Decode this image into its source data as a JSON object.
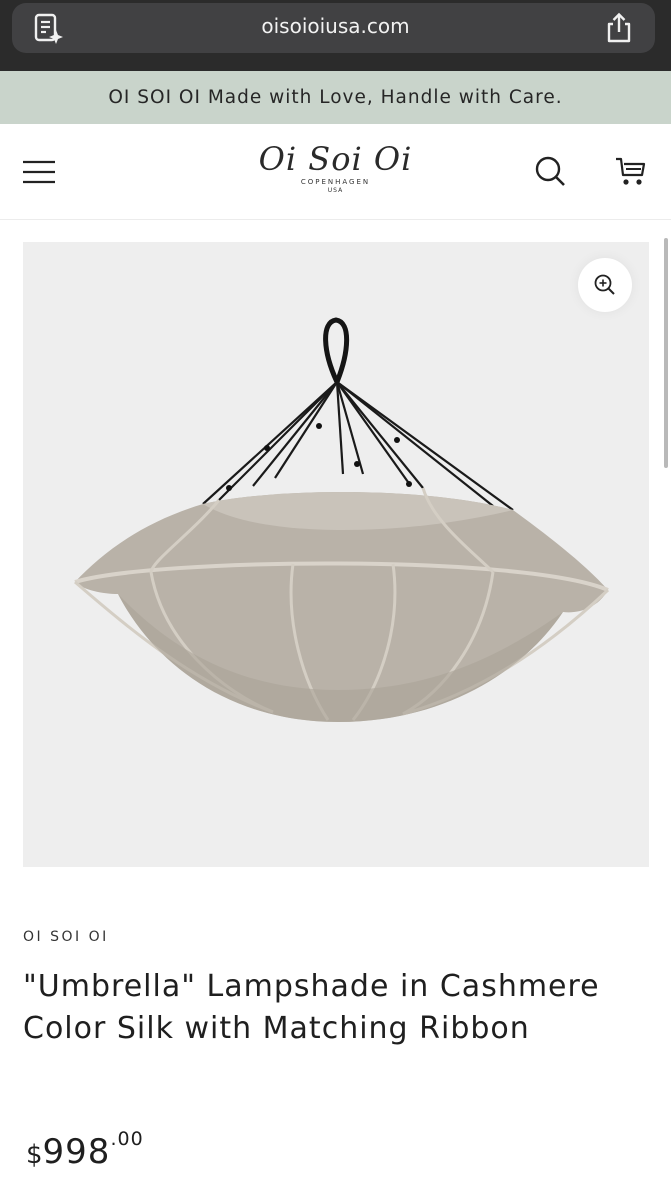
{
  "browser": {
    "url": "oisoioiusa.com",
    "reader_icon": "reader-mode-icon",
    "share_icon": "share-icon"
  },
  "announcement": {
    "text": "OI SOI OI Made with Love, Handle with Care."
  },
  "header": {
    "logo_main": "Oi Soi Oi",
    "logo_sub": "COPENHAGEN",
    "logo_region": "USA",
    "icons": [
      "menu-icon",
      "search-icon",
      "cart-icon"
    ]
  },
  "product": {
    "vendor": "OI SOI OI",
    "title": "\"Umbrella\" Lampshade in Cashmere Color Silk with Matching Ribbon",
    "price_currency": "$",
    "price_main": "998",
    "price_cents": ".00",
    "zoom_icon": "zoom-in-icon"
  },
  "colors": {
    "announcement_bg": "#c9d4cb",
    "media_bg": "#eeeeee",
    "shade": "#b9b2a8"
  }
}
